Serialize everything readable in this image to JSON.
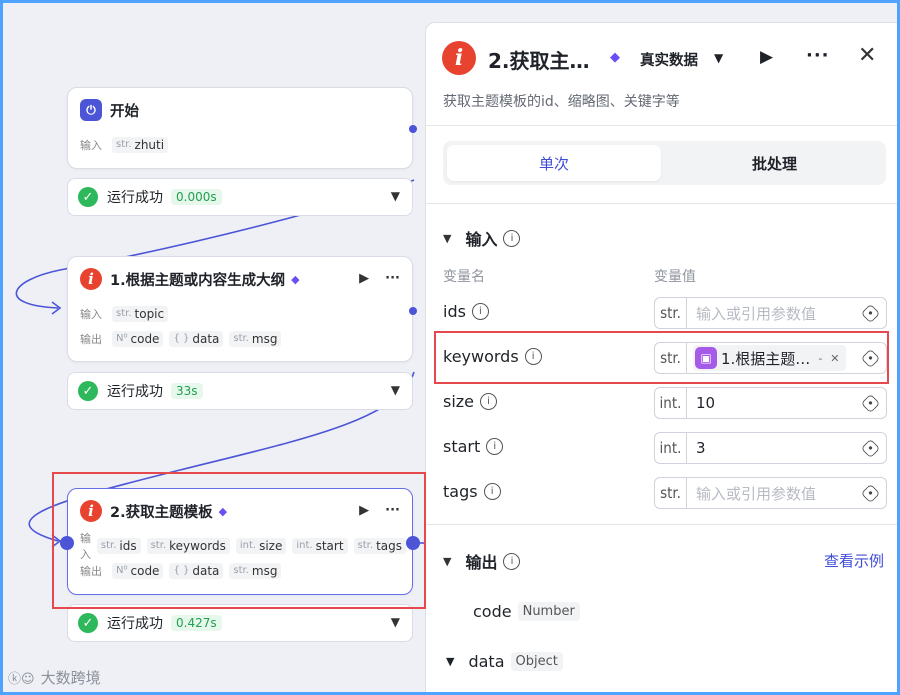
{
  "workflow": {
    "start_node": {
      "title": "开始",
      "input_label": "输入",
      "inputs": [
        {
          "type": "str.",
          "name": "zhuti"
        }
      ],
      "status": "运行成功",
      "time": "0.000s"
    },
    "node1": {
      "title": "1.根据主题或内容生成大纲",
      "input_label": "输入",
      "output_label": "输出",
      "inputs": [
        {
          "type": "str.",
          "name": "topic"
        }
      ],
      "outputs": [
        {
          "type": "N⁰",
          "name": "code"
        },
        {
          "type": "{ }",
          "name": "data"
        },
        {
          "type": "str.",
          "name": "msg"
        }
      ],
      "status": "运行成功",
      "time": "33s"
    },
    "node2": {
      "title": "2.获取主题模板",
      "input_label": "输入",
      "output_label": "输出",
      "inputs": [
        {
          "type": "str.",
          "name": "ids"
        },
        {
          "type": "str.",
          "name": "keywords"
        },
        {
          "type": "int.",
          "name": "size"
        },
        {
          "type": "int.",
          "name": "start"
        },
        {
          "type": "str.",
          "name": "tags"
        }
      ],
      "outputs": [
        {
          "type": "N⁰",
          "name": "code"
        },
        {
          "type": "{ }",
          "name": "data"
        },
        {
          "type": "str.",
          "name": "msg"
        }
      ],
      "status": "运行成功",
      "time": "0.427s"
    }
  },
  "panel": {
    "title": "2.获取主…",
    "mode": "真实数据",
    "description": "获取主题模板的id、缩略图、关键字等",
    "tabs": {
      "single": "单次",
      "batch": "批处理"
    },
    "input_section": "输入",
    "col_name": "变量名",
    "col_value": "变量值",
    "params": [
      {
        "name": "ids",
        "type": "str.",
        "placeholder": "输入或引用参数值",
        "value": ""
      },
      {
        "name": "keywords",
        "type": "str.",
        "ref": "1.根据主题…",
        "ref_suffix": "-"
      },
      {
        "name": "size",
        "type": "int.",
        "value": "10"
      },
      {
        "name": "start",
        "type": "int.",
        "value": "3"
      },
      {
        "name": "tags",
        "type": "str.",
        "placeholder": "输入或引用参数值",
        "value": ""
      }
    ],
    "output_section": "输出",
    "view_example": "查看示例",
    "outputs": [
      {
        "name": "code",
        "type": "Number"
      },
      {
        "name": "data",
        "type": "Object"
      }
    ]
  },
  "watermark": "大数跨境",
  "colors": {
    "accent": "#3f4dd6",
    "success": "#2db85c",
    "highlight": "#e5484d",
    "node_logo": "#e8432f",
    "premium": "#6b4ef5"
  }
}
